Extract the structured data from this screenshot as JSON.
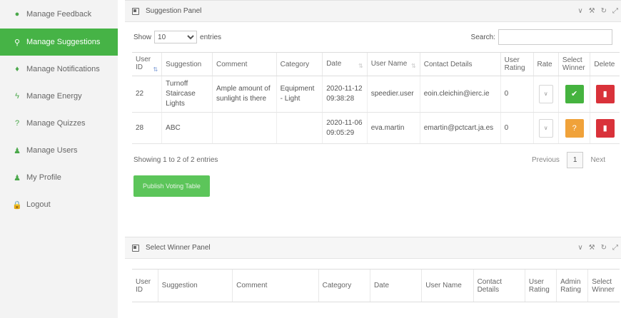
{
  "sidebar": {
    "items": [
      {
        "label": "Manage Feedback",
        "icon": "comment-icon",
        "glyph": "●"
      },
      {
        "label": "Manage Suggestions",
        "icon": "search-icon",
        "glyph": "⚲"
      },
      {
        "label": "Manage Notifications",
        "icon": "bell-icon",
        "glyph": "♦"
      },
      {
        "label": "Manage Energy",
        "icon": "bolt-icon",
        "glyph": "ϟ"
      },
      {
        "label": "Manage Quizzes",
        "icon": "question-icon",
        "glyph": "?"
      },
      {
        "label": "Manage Users",
        "icon": "user-icon",
        "glyph": "♟"
      },
      {
        "label": "My Profile",
        "icon": "user-icon",
        "glyph": "♟"
      },
      {
        "label": "Logout",
        "icon": "lock-icon",
        "glyph": "🔒"
      }
    ],
    "active_index": 1,
    "accent": "#46b346"
  },
  "suggestion_panel": {
    "title": "Suggestion Panel",
    "show_label": "Show",
    "entries_value": "10",
    "entries_label": "entries",
    "search_label": "Search:",
    "columns": [
      "User ID",
      "Suggestion",
      "Comment",
      "Category",
      "Date",
      "User Name",
      "Contact Details",
      "User Rating",
      "Rate",
      "Select Winner",
      "Delete"
    ],
    "rows": [
      {
        "user_id": "22",
        "suggestion": "Turnoff Staircase Lights",
        "comment": "Ample amount of sunlight is there",
        "category": "Equipment - Light",
        "date": "2020-11-12 09:38:28",
        "user_name": "speedier.user",
        "contact": "eoin.cleichin@ierc.ie",
        "rating": "0",
        "winner_icon": "check-icon",
        "winner_glyph": "✔"
      },
      {
        "user_id": "28",
        "suggestion": "ABC",
        "comment": "",
        "category": "",
        "date": "2020-11-06 09:05:29",
        "user_name": "eva.martin",
        "contact": "emartin@pctcart.ja.es",
        "rating": "0",
        "winner_icon": "question-icon",
        "winner_glyph": "?"
      }
    ],
    "info": "Showing 1 to 2 of 2 entries",
    "previous": "Previous",
    "page": "1",
    "next": "Next",
    "publish_label": "Publish Voting Table"
  },
  "winner_panel": {
    "title": "Select Winner Panel",
    "columns": [
      "User ID",
      "Suggestion",
      "Comment",
      "Category",
      "Date",
      "User Name",
      "Contact Details",
      "User Rating",
      "Admin Rating",
      "Select Winner"
    ]
  },
  "tools": {
    "collapse": "∨",
    "wrench": "⚒",
    "refresh": "↻",
    "expand": "⤢",
    "close": "×"
  }
}
